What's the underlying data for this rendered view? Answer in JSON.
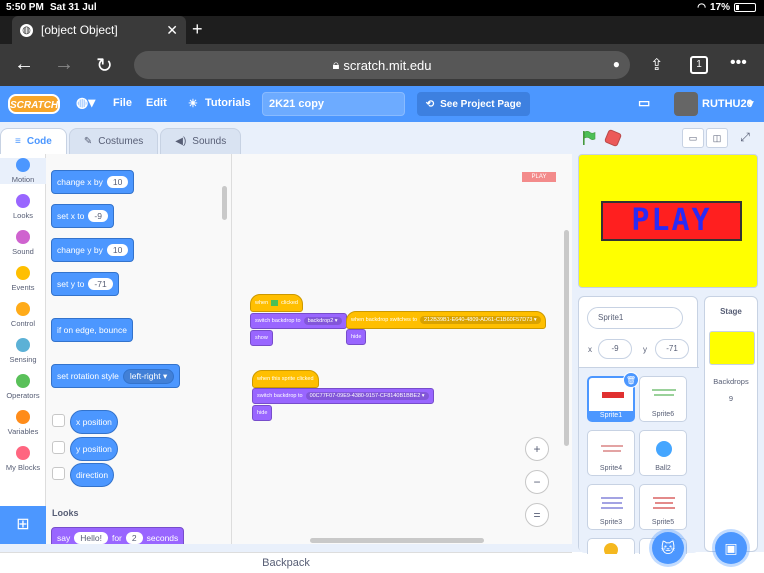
{
  "status_bar": {
    "time": "5:50 PM",
    "date": "Sat 31 Jul",
    "battery": "17%"
  },
  "browser": {
    "tab_title": "[object Object]",
    "url": "scratch.mit.edu",
    "tab_count": "1"
  },
  "menubar": {
    "logo": "SCRATCH",
    "file": "File",
    "edit": "Edit",
    "tutorials": "Tutorials",
    "project_title": "2K21 copy",
    "see_project": "See Project Page",
    "username": "RUTHU20"
  },
  "editor_tabs": {
    "code": "Code",
    "costumes": "Costumes",
    "sounds": "Sounds"
  },
  "categories": [
    {
      "label": "Motion",
      "color": "#4c97ff"
    },
    {
      "label": "Looks",
      "color": "#9966ff"
    },
    {
      "label": "Sound",
      "color": "#cf63cf"
    },
    {
      "label": "Events",
      "color": "#ffbf00"
    },
    {
      "label": "Control",
      "color": "#ffab19"
    },
    {
      "label": "Sensing",
      "color": "#5cb1d6"
    },
    {
      "label": "Operators",
      "color": "#59c059"
    },
    {
      "label": "Variables",
      "color": "#ff8c1a"
    },
    {
      "label": "My Blocks",
      "color": "#ff6680"
    }
  ],
  "palette": {
    "change_x": "change x by",
    "change_x_val": "10",
    "set_x": "set x to",
    "set_x_val": "-9",
    "change_y": "change y by",
    "change_y_val": "10",
    "set_y": "set y to",
    "set_y_val": "-71",
    "bounce": "if on edge, bounce",
    "rotation": "set rotation style",
    "rotation_val": "left-right",
    "x_position": "x position",
    "y_position": "y position",
    "direction": "direction",
    "looks_heading": "Looks",
    "say": "say",
    "say_val": "Hello!",
    "say_for": "for",
    "say_secs_val": "2",
    "say_secs": "seconds"
  },
  "workspace": {
    "note": "PLAY",
    "script1": {
      "hat": "when",
      "hat_tail": "clicked",
      "switch": "switch backdrop to",
      "switch_val": "backdrop2",
      "show": "show"
    },
    "script2": {
      "hat": "when backdrop switches to",
      "hat_val": "212B39B1-E640-4809-AD61-C1B60F57D73",
      "hide": "hide"
    },
    "script3": {
      "hat": "when this sprite clicked",
      "switch": "switch backdrop to",
      "switch_val": "00C77F07-09E9-4380-9157-CF8140B1BBE2",
      "hide": "hide"
    },
    "zoom_in": "+",
    "zoom_out": "−",
    "zoom_reset": "="
  },
  "backpack": "Backpack",
  "stage": {
    "display_text": "PLAY",
    "background": "#ffff00"
  },
  "sprite_info": {
    "name": "Sprite1",
    "x_label": "x",
    "x_val": "-9",
    "y_label": "y",
    "y_val": "-71"
  },
  "sprites": [
    "Sprite1",
    "Sprite6",
    "Sprite4",
    "Ball2",
    "Sprite3",
    "Sprite5"
  ],
  "stage_pane": {
    "header": "Stage",
    "backdrops_label": "Backdrops",
    "backdrops_count": "9"
  }
}
